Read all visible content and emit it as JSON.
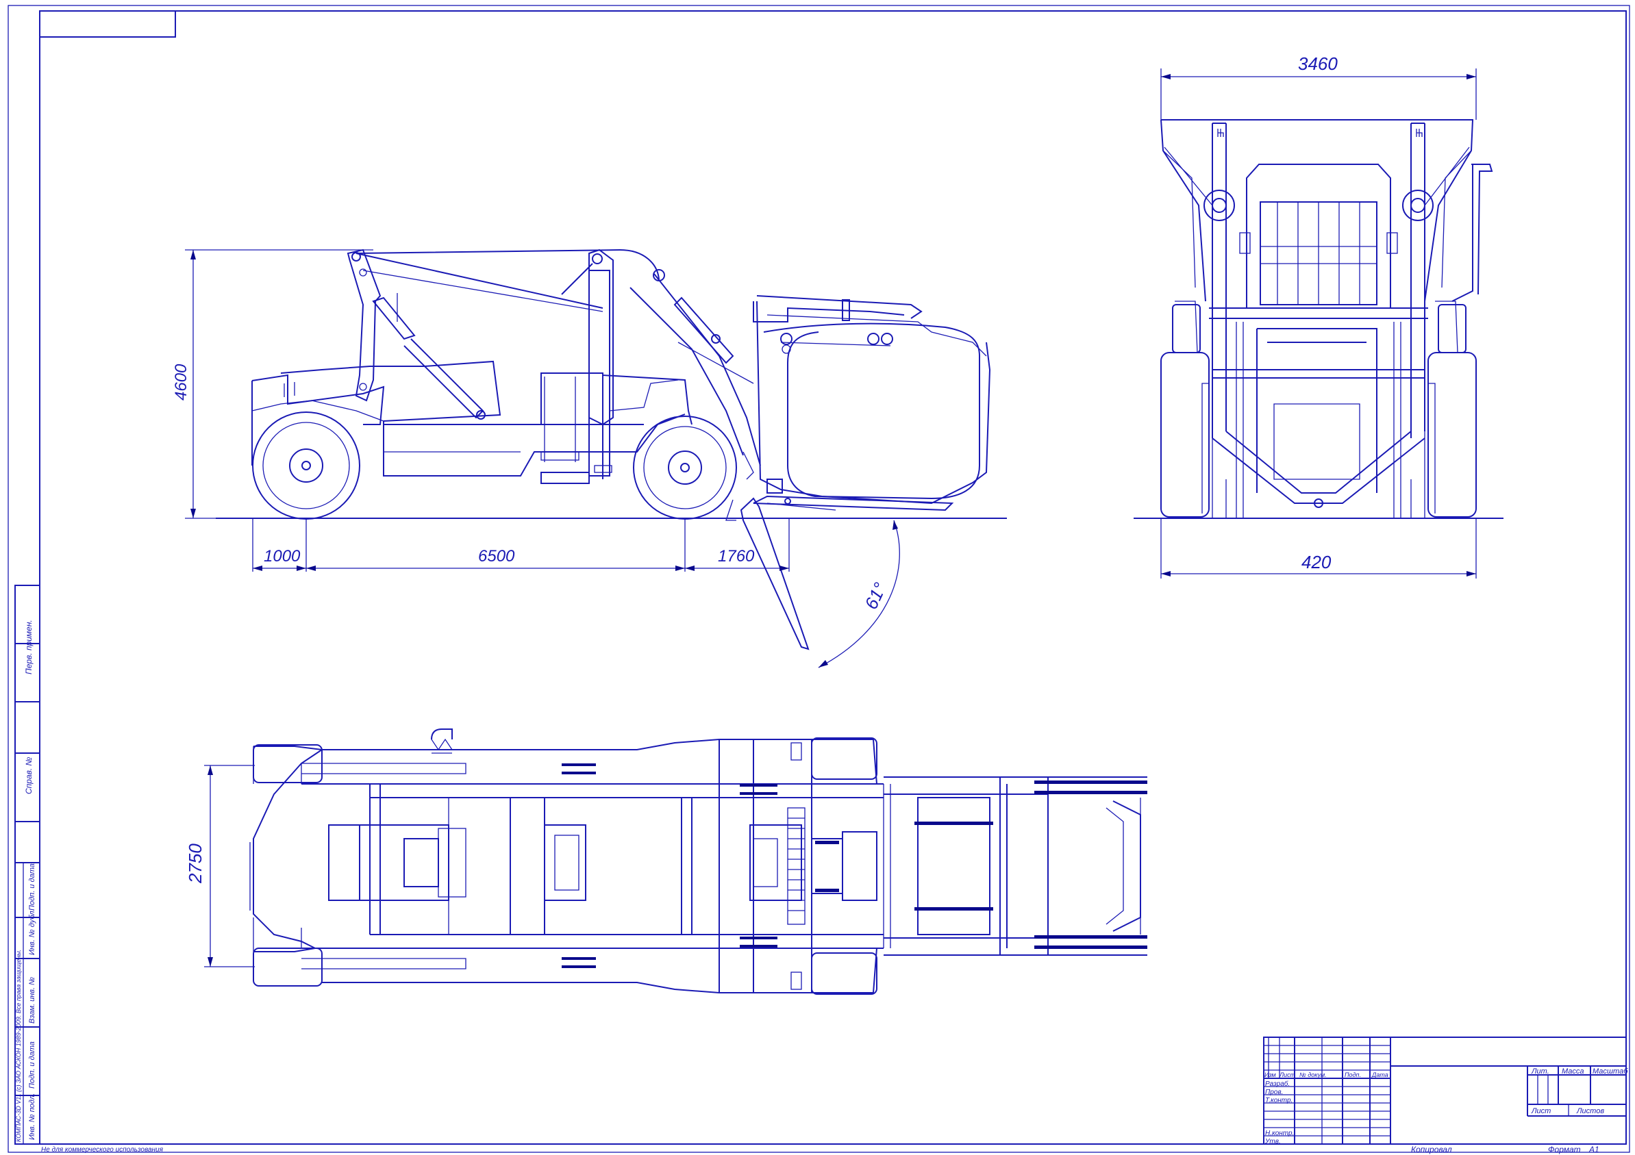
{
  "drawing": {
    "accent_color": "#1a1ab4",
    "dim_side": {
      "height": "4600",
      "rear_overhang": "1000",
      "wheelbase": "6500",
      "front_overhang": "1760",
      "angle": "61°"
    },
    "dim_front": {
      "width_top": "3460",
      "width_bottom": "420"
    },
    "dim_plan": {
      "track": "2750"
    }
  },
  "left_strip": {
    "top_labels": [
      "Перв. примен.",
      "Справ. №"
    ],
    "bottom_labels": [
      "Подп. и дата",
      "Инв. № дубл.",
      "Взам. инв. №",
      "Подп. и дата",
      "Инв. № подл."
    ],
    "copyright": "КОМПАС-3D V11 (с) ЗАО АСКОН 1989-2009. Все права защищены."
  },
  "title_block": {
    "cols": [
      "Изм",
      "Лист",
      "№ докум.",
      "Подп.",
      "Дата"
    ],
    "rows": [
      "Разраб.",
      "Пров.",
      "Т.контр.",
      "",
      "Н.контр.",
      "Утв."
    ],
    "right_head": [
      "Лит.",
      "Масса",
      "Масштаб"
    ],
    "sheet_labels": [
      "Лист",
      "Листов"
    ]
  },
  "footer": {
    "left_note": "Не для коммерческого использования",
    "copied": "Копировал",
    "format_label": "Формат",
    "format_value": "A1"
  }
}
